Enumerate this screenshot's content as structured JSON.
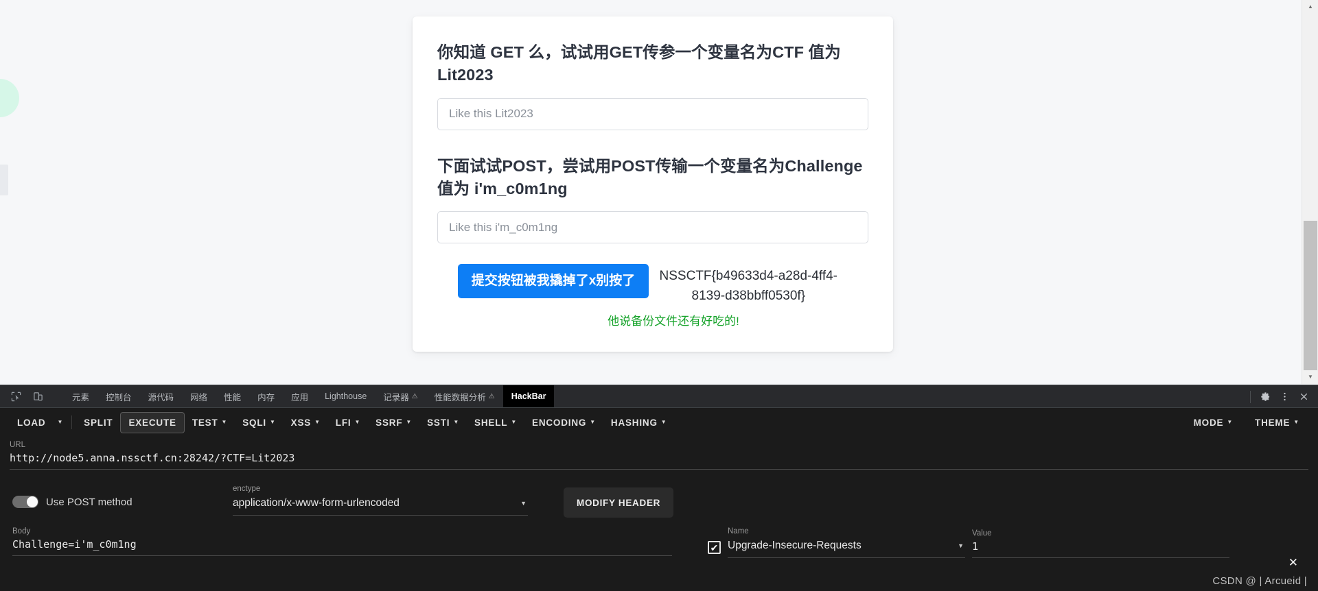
{
  "page": {
    "card": {
      "get_heading": "你知道 GET 么，试试用GET传参一个变量名为CTF 值为 Lit2023",
      "get_input_placeholder": "Like this Lit2023",
      "get_input_value": "",
      "post_heading": "下面试试POST，尝试用POST传输一个变量名为Challenge 值为 i'm_c0m1ng",
      "post_input_placeholder": "Like this i'm_c0m1ng",
      "post_input_value": "",
      "submit_label": "提交按钮被我撬掉了x别按了",
      "flag": "NSSCTF{b49633d4-a28d-4ff4-8139-d38bbff0530f}",
      "green_note": "他说备份文件还有好吃的!",
      "accent_blue": "#0d7ef5",
      "green_color": "#16a32a"
    },
    "scrollbar": {
      "up_arrow": "▲",
      "down_arrow": "▼"
    }
  },
  "devtools": {
    "left_icons": [
      {
        "name": "inspect-element-icon",
        "glyph": "inspect"
      },
      {
        "name": "device-toolbar-icon",
        "glyph": "device"
      }
    ],
    "tabs": [
      {
        "label": "元素",
        "active": false,
        "warn": ""
      },
      {
        "label": "控制台",
        "active": false,
        "warn": ""
      },
      {
        "label": "源代码",
        "active": false,
        "warn": ""
      },
      {
        "label": "网络",
        "active": false,
        "warn": ""
      },
      {
        "label": "性能",
        "active": false,
        "warn": ""
      },
      {
        "label": "内存",
        "active": false,
        "warn": ""
      },
      {
        "label": "应用",
        "active": false,
        "warn": ""
      },
      {
        "label": "Lighthouse",
        "active": false,
        "warn": ""
      },
      {
        "label": "记录器",
        "active": false,
        "warn": "⚠"
      },
      {
        "label": "性能数据分析",
        "active": false,
        "warn": "⚠"
      },
      {
        "label": "HackBar",
        "active": true,
        "warn": ""
      }
    ],
    "right_icons": [
      {
        "name": "settings-gear-icon",
        "glyph": "✦"
      },
      {
        "name": "more-options-icon",
        "glyph": "⋮"
      },
      {
        "name": "close-devtools-icon",
        "glyph": "✕"
      }
    ]
  },
  "hackbar": {
    "menu": [
      {
        "label": "LOAD",
        "caret": true,
        "boxed": false,
        "separate_caret": true
      },
      {
        "label": "SPLIT",
        "caret": false,
        "boxed": false
      },
      {
        "label": "EXECUTE",
        "caret": false,
        "boxed": true
      },
      {
        "label": "TEST",
        "caret": true,
        "boxed": false
      },
      {
        "label": "SQLI",
        "caret": true,
        "boxed": false
      },
      {
        "label": "XSS",
        "caret": true,
        "boxed": false
      },
      {
        "label": "LFI",
        "caret": true,
        "boxed": false
      },
      {
        "label": "SSRF",
        "caret": true,
        "boxed": false
      },
      {
        "label": "SSTI",
        "caret": true,
        "boxed": false
      },
      {
        "label": "SHELL",
        "caret": true,
        "boxed": false
      },
      {
        "label": "ENCODING",
        "caret": true,
        "boxed": false
      },
      {
        "label": "HASHING",
        "caret": true,
        "boxed": false
      }
    ],
    "menu_right": [
      {
        "label": "MODE",
        "caret": true
      },
      {
        "label": "THEME",
        "caret": true
      }
    ],
    "url_label": "URL",
    "url_value": "http://node5.anna.nssctf.cn:28242/?CTF=Lit2023",
    "post_toggle_label": "Use POST method",
    "post_toggle_on": false,
    "enctype_label": "enctype",
    "enctype_value": "application/x-www-form-urlencoded",
    "modify_header_label": "MODIFY HEADER",
    "body_label": "Body",
    "body_value": "Challenge=i'm_c0m1ng",
    "header_name_label": "Name",
    "header_name_value": "Upgrade-Insecure-Requests",
    "header_value_label": "Value",
    "header_value_value": "1",
    "header_enabled": true,
    "remove_header_glyph": "✕",
    "dropdown_caret": "▼"
  },
  "watermark": "CSDN @ | Arcueid |"
}
